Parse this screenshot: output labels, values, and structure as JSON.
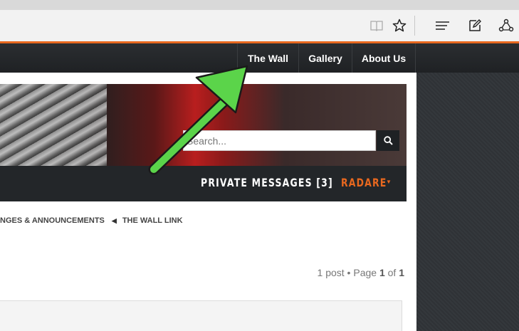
{
  "browser": {
    "icons": [
      "reading-view-icon",
      "favorite-star-icon",
      "hub-icon",
      "web-note-icon",
      "share-icon"
    ]
  },
  "nav": {
    "items": [
      {
        "label": "The Wall"
      },
      {
        "label": "Gallery"
      },
      {
        "label": "About Us"
      }
    ]
  },
  "search": {
    "placeholder": "Search..."
  },
  "user_bar": {
    "private_messages": "PRIVATE MESSAGES [3]",
    "username": "RADARE"
  },
  "breadcrumbs": {
    "items": [
      "NGES & ANNOUNCEMENTS",
      "THE WALL LINK"
    ]
  },
  "pagination": {
    "prefix": "1 post • Page ",
    "current": "1",
    "of": " of ",
    "total": "1"
  },
  "colors": {
    "accent": "#e8681f",
    "arrow": "#5bd44a",
    "nav_bg": "#25282b"
  }
}
